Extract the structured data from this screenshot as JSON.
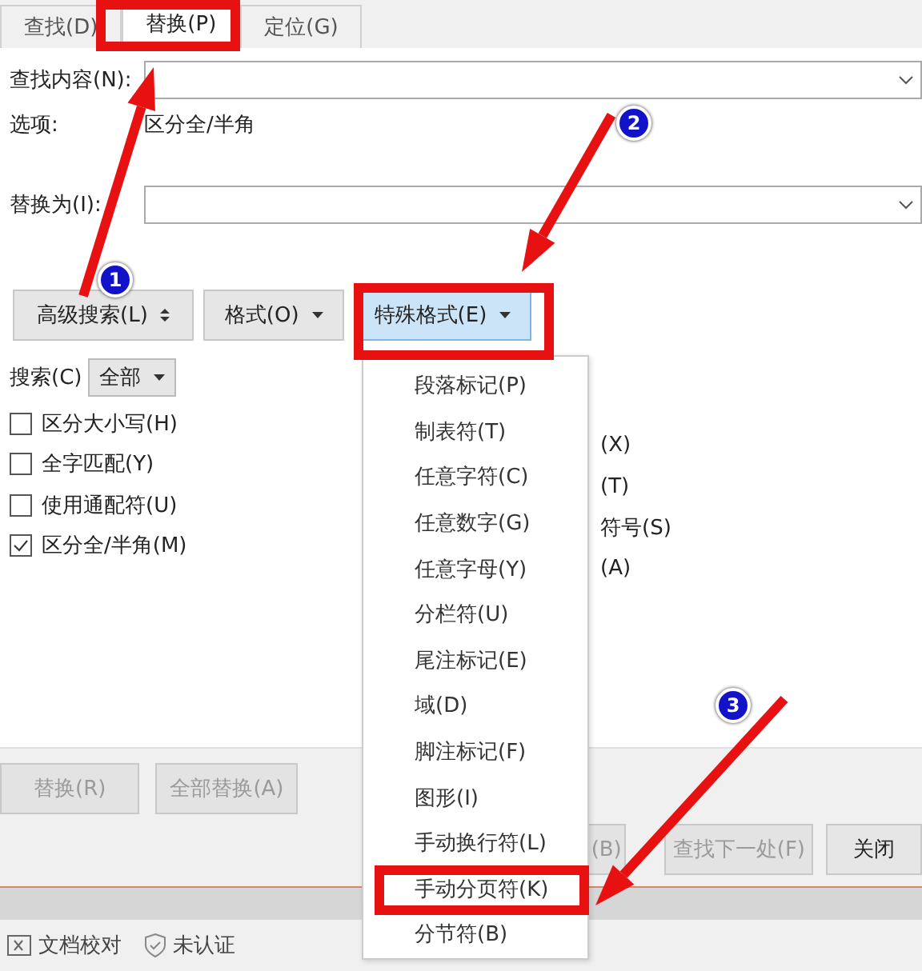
{
  "tabs": [
    {
      "label": "查找(D)",
      "selected": false
    },
    {
      "label": "替换(P)",
      "selected": true
    },
    {
      "label": "定位(G)",
      "selected": false
    }
  ],
  "find": {
    "label": "查找内容(N):"
  },
  "options": {
    "label": "选项:",
    "value": "区分全/半角"
  },
  "replace": {
    "label": "替换为(I):"
  },
  "toolbar": [
    {
      "label": "高级搜索(L)",
      "kind": "expander",
      "selected": false
    },
    {
      "label": "格式(O)",
      "kind": "dropdown",
      "selected": false
    },
    {
      "label": "特殊格式(E)",
      "kind": "dropdown",
      "selected": true
    }
  ],
  "search": {
    "label": "搜索(C)",
    "value": "全部"
  },
  "checkboxes": [
    {
      "label": "区分大小写(H)",
      "checked": false
    },
    {
      "label": "全字匹配(Y)",
      "checked": false
    },
    {
      "label": "使用通配符(U)",
      "checked": false
    },
    {
      "label": "区分全/半角(M)",
      "checked": true
    }
  ],
  "right_options": [
    "(X)",
    "(T)",
    "符号(S)",
    "(A)"
  ],
  "replace_buttons": [
    {
      "label": "替换(R)",
      "disabled": true
    },
    {
      "label": "全部替换(A)",
      "disabled": true
    }
  ],
  "nav_buttons": [
    {
      "label": "(B)",
      "disabled": true
    },
    {
      "label": "查找下一处(F)",
      "disabled": true
    },
    {
      "label": "关闭",
      "disabled": false
    }
  ],
  "status_bar": [
    "文档校对",
    "未认证"
  ],
  "menu": {
    "items": [
      {
        "label": "段落标记(P)",
        "highlighted": false
      },
      {
        "label": "制表符(T)",
        "highlighted": false
      },
      {
        "label": "任意字符(C)",
        "highlighted": false
      },
      {
        "label": "任意数字(G)",
        "highlighted": false
      },
      {
        "label": "任意字母(Y)",
        "highlighted": false
      },
      {
        "label": "分栏符(U)",
        "highlighted": false
      },
      {
        "label": "尾注标记(E)",
        "highlighted": false
      },
      {
        "label": "域(D)",
        "highlighted": false
      },
      {
        "label": "脚注标记(F)",
        "highlighted": false
      },
      {
        "label": "图形(I)",
        "highlighted": false
      },
      {
        "label": "手动换行符(L)",
        "highlighted": false
      },
      {
        "label": "手动分页符(K)",
        "highlighted": true
      },
      {
        "label": "分节符(B)",
        "highlighted": false
      }
    ]
  },
  "annotations": [
    "1",
    "2",
    "3"
  ]
}
